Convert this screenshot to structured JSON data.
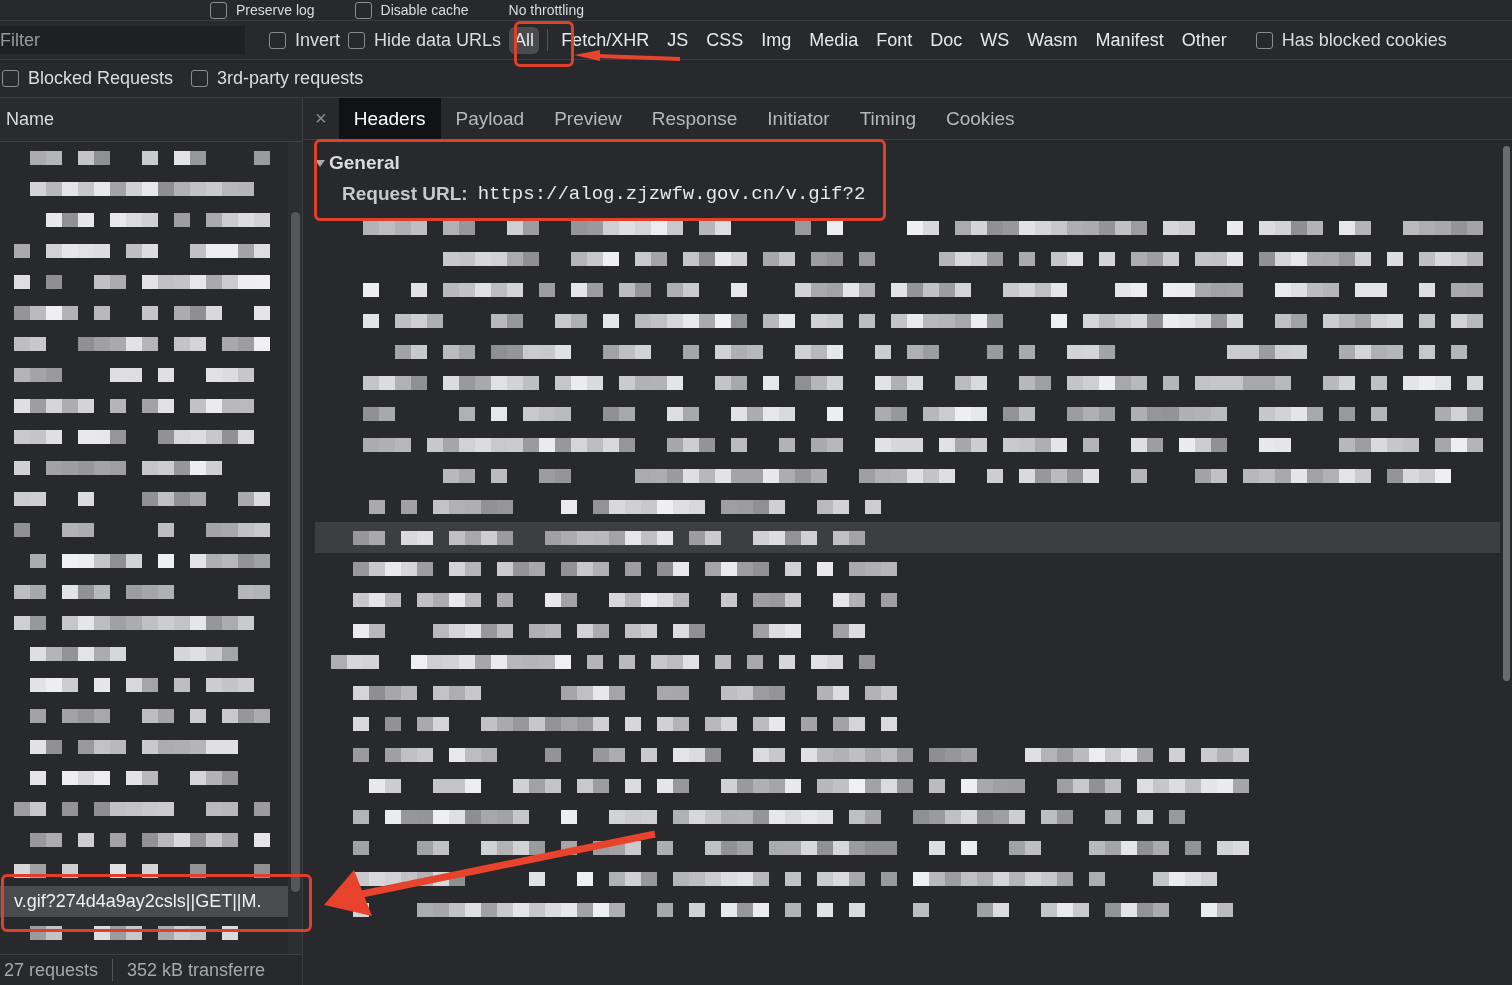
{
  "toolbar": {
    "items": [
      {
        "kind": "checkbox",
        "label": "Preserve log",
        "checked": false
      },
      {
        "kind": "checkbox",
        "label": "Disable cache",
        "checked": false
      },
      {
        "kind": "text",
        "label": "No throttling"
      }
    ]
  },
  "filter_bar": {
    "placeholder": "Filter",
    "options": [
      {
        "label": "Invert",
        "checked": false
      },
      {
        "label": "Hide data URLs",
        "checked": false
      }
    ],
    "types": [
      {
        "label": "All",
        "selected": true
      },
      {
        "label": "Fetch/XHR",
        "selected": false
      },
      {
        "label": "JS",
        "selected": false
      },
      {
        "label": "CSS",
        "selected": false
      },
      {
        "label": "Img",
        "selected": false
      },
      {
        "label": "Media",
        "selected": false
      },
      {
        "label": "Font",
        "selected": false
      },
      {
        "label": "Doc",
        "selected": false
      },
      {
        "label": "WS",
        "selected": false
      },
      {
        "label": "Wasm",
        "selected": false
      },
      {
        "label": "Manifest",
        "selected": false
      },
      {
        "label": "Other",
        "selected": false
      }
    ],
    "extra": {
      "label": "Has blocked cookies",
      "checked": false
    },
    "second_row": [
      {
        "label": "Blocked Requests",
        "checked": false
      },
      {
        "label": "3rd-party requests",
        "checked": false
      }
    ]
  },
  "request_list": {
    "column": "Name",
    "rows": [
      {
        "kind": "pixelated",
        "selected": false
      },
      {
        "kind": "pixelated",
        "selected": false
      },
      {
        "kind": "pixelated",
        "selected": false
      },
      {
        "kind": "pixelated",
        "selected": false
      },
      {
        "kind": "pixelated",
        "selected": false
      },
      {
        "kind": "pixelated",
        "selected": false
      },
      {
        "kind": "pixelated",
        "selected": false
      },
      {
        "kind": "pixelated",
        "selected": false
      },
      {
        "kind": "pixelated",
        "selected": false
      },
      {
        "kind": "pixelated",
        "selected": false
      },
      {
        "kind": "pixelated",
        "selected": false
      },
      {
        "kind": "pixelated",
        "selected": false
      },
      {
        "kind": "pixelated",
        "selected": false
      },
      {
        "kind": "pixelated",
        "selected": false
      },
      {
        "kind": "pixelated",
        "selected": false
      },
      {
        "kind": "pixelated",
        "selected": false
      },
      {
        "kind": "pixelated",
        "selected": false
      },
      {
        "kind": "pixelated",
        "selected": false
      },
      {
        "kind": "pixelated",
        "selected": false
      },
      {
        "kind": "pixelated",
        "selected": false
      },
      {
        "kind": "pixelated",
        "selected": false
      },
      {
        "kind": "pixelated",
        "selected": false
      },
      {
        "kind": "pixelated",
        "selected": false
      },
      {
        "kind": "pixelated",
        "selected": false
      },
      {
        "kind": "text",
        "name": "v.gif?274d4a9ay2csls||GET||M.",
        "selected": true
      },
      {
        "kind": "pixelated",
        "selected": false
      }
    ]
  },
  "status_bar": [
    "27 requests",
    "352 kB transferre"
  ],
  "detail": {
    "close": "×",
    "tabs": [
      {
        "label": "Headers",
        "selected": true
      },
      {
        "label": "Payload",
        "selected": false
      },
      {
        "label": "Preview",
        "selected": false
      },
      {
        "label": "Response",
        "selected": false
      },
      {
        "label": "Initiator",
        "selected": false
      },
      {
        "label": "Timing",
        "selected": false
      },
      {
        "label": "Cookies",
        "selected": false
      }
    ],
    "general": {
      "title": "General",
      "expanded": true,
      "request_url": {
        "label": "Request URL:",
        "value": "https://alog.zjzwfw.gov.cn/v.gif?2"
      }
    }
  }
}
